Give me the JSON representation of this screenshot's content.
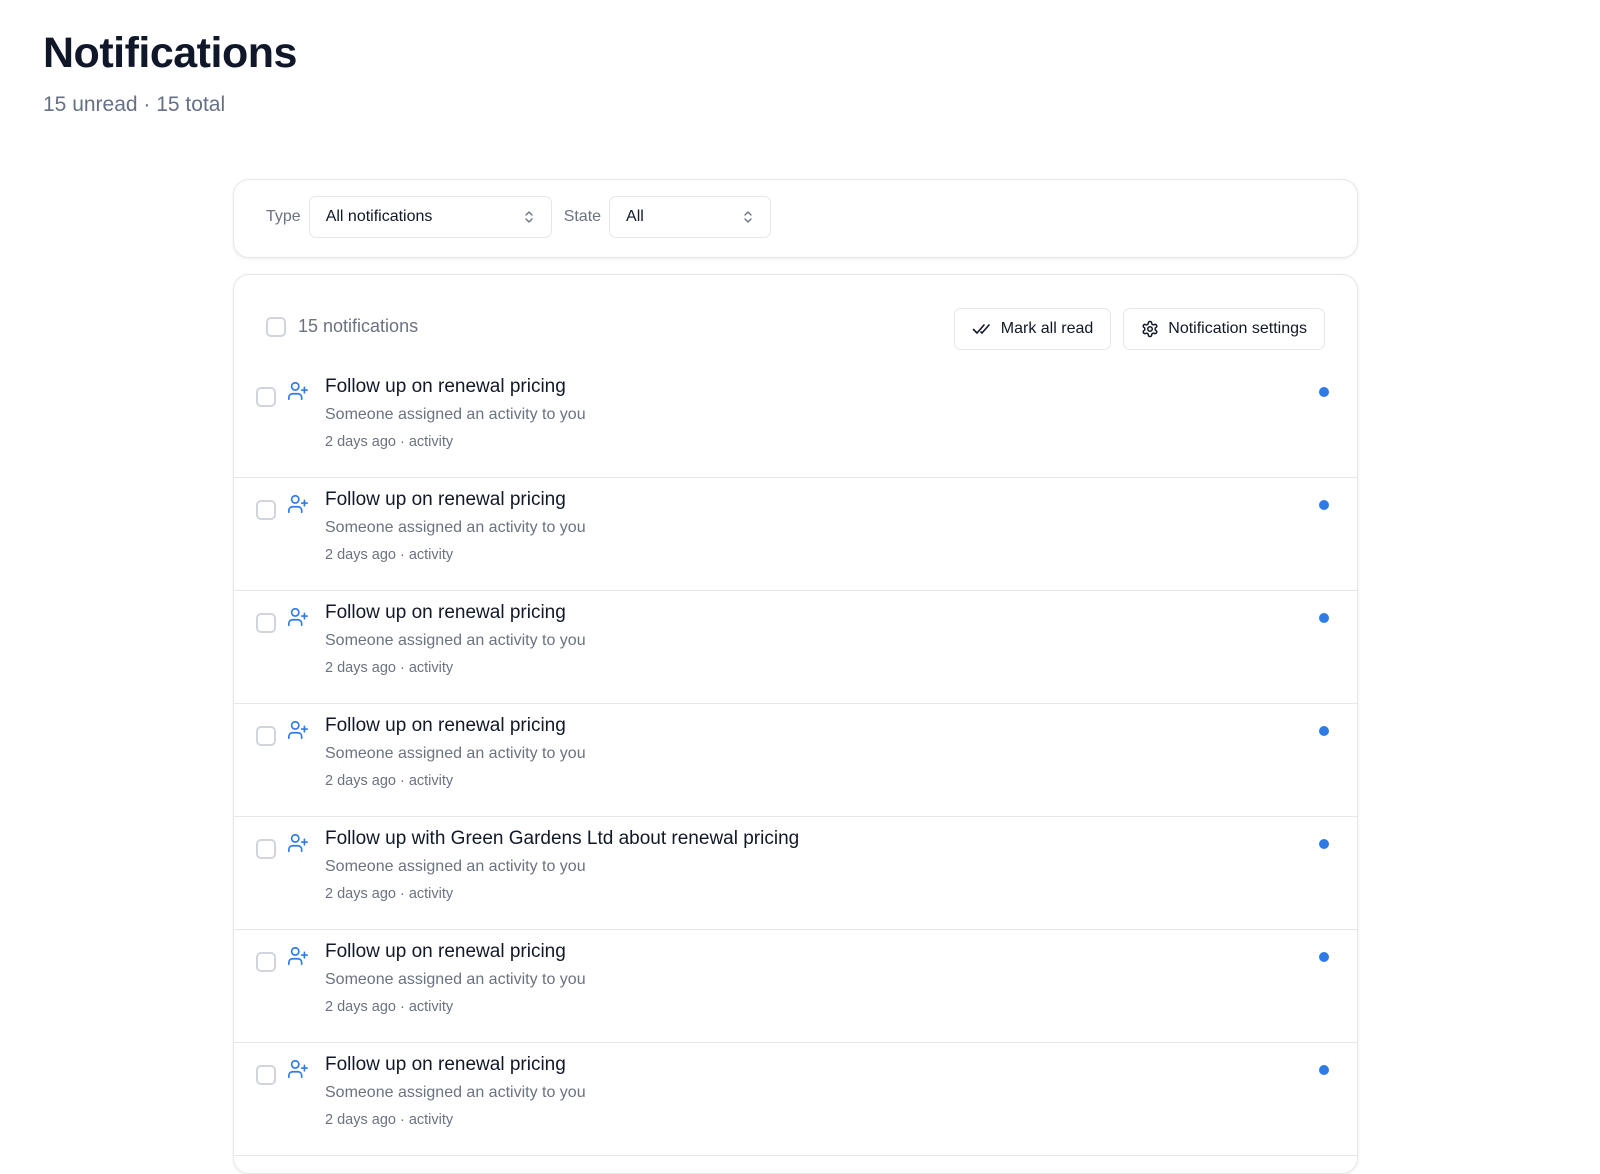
{
  "page": {
    "title": "Notifications",
    "subtitle": "15 unread · 15 total"
  },
  "filters": {
    "type_label": "Type",
    "type_value": "All notifications",
    "state_label": "State",
    "state_value": "All"
  },
  "list": {
    "count_label": "15 notifications",
    "mark_all_read_label": "Mark all read",
    "settings_label": "Notification settings",
    "unread_color": "#2f7be6",
    "icon_color": "#2f7be6",
    "items": [
      {
        "title": "Follow up on renewal pricing",
        "description": "Someone assigned an activity to you",
        "meta": "2 days ago · activity",
        "icon": "user-plus-icon",
        "unread": true
      },
      {
        "title": "Follow up on renewal pricing",
        "description": "Someone assigned an activity to you",
        "meta": "2 days ago · activity",
        "icon": "user-plus-icon",
        "unread": true
      },
      {
        "title": "Follow up on renewal pricing",
        "description": "Someone assigned an activity to you",
        "meta": "2 days ago · activity",
        "icon": "user-plus-icon",
        "unread": true
      },
      {
        "title": "Follow up on renewal pricing",
        "description": "Someone assigned an activity to you",
        "meta": "2 days ago · activity",
        "icon": "user-plus-icon",
        "unread": true
      },
      {
        "title": "Follow up with Green Gardens Ltd about renewal pricing",
        "description": "Someone assigned an activity to you",
        "meta": "2 days ago · activity",
        "icon": "user-plus-icon",
        "unread": true
      },
      {
        "title": "Follow up on renewal pricing",
        "description": "Someone assigned an activity to you",
        "meta": "2 days ago · activity",
        "icon": "user-plus-icon",
        "unread": true
      },
      {
        "title": "Follow up on renewal pricing",
        "description": "Someone assigned an activity to you",
        "meta": "2 days ago · activity",
        "icon": "user-plus-icon",
        "unread": true
      }
    ]
  }
}
